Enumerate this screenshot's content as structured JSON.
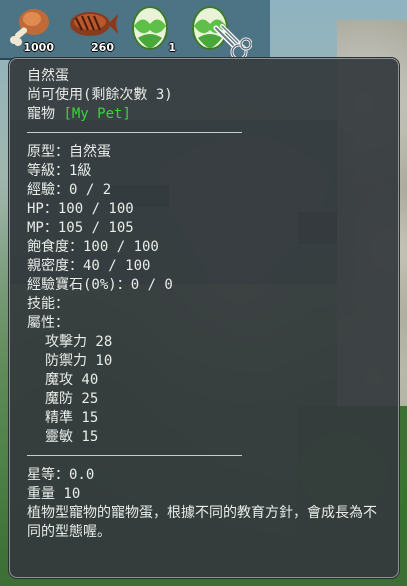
{
  "inventory": {
    "slots": [
      {
        "icon": "drumstick-icon",
        "count": "1000"
      },
      {
        "icon": "grilled-fish-icon",
        "count": "260"
      },
      {
        "icon": "green-egg-icon",
        "count": "1"
      },
      {
        "icon": "green-egg-icon",
        "count": ""
      }
    ]
  },
  "tooltip": {
    "item_name": "自然蛋",
    "usage": "尚可使用(剩餘次數 3)",
    "pet_type_label": "寵物",
    "pet_tag": "[My Pet]",
    "prototype": "原型：自然蛋",
    "level": "等級：1級",
    "experience": "經驗：0 / 2",
    "hp": "HP：100 / 100",
    "mp": "MP：105 / 105",
    "satiety": "飽食度：100 / 100",
    "intimacy": "親密度：40 / 100",
    "exp_gem": "經驗寶石(0%)：0 / 0",
    "skills": "技能：",
    "attributes_header": "屬性：",
    "attributes": [
      "攻擊力 28",
      "防禦力 10",
      "魔攻 40",
      "魔防 25",
      "精準 15",
      "靈敏 15"
    ],
    "star_rank": "星等：0.0",
    "weight": "重量 10",
    "description": "植物型寵物的寵物蛋，根據不同的教育方針，會成長為不同的型態喔。"
  },
  "colors": {
    "tooltip_bg": "#34393c",
    "pet_tag": "#38d638",
    "text": "#e9ece8"
  }
}
